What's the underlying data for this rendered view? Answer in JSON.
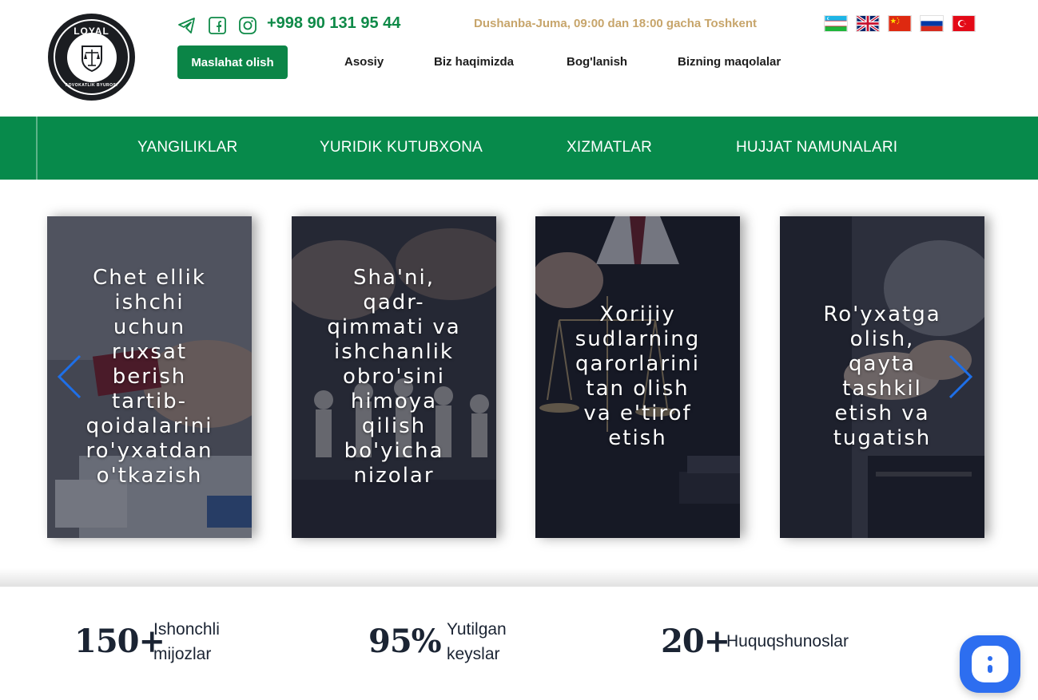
{
  "header": {
    "logo": {
      "top_text": "LOYAL",
      "bottom_text": "ADVOKATLIK BYUROSI",
      "icon": "scales-of-justice-icon"
    },
    "social": [
      {
        "icon": "telegram-icon"
      },
      {
        "icon": "facebook-icon"
      },
      {
        "icon": "instagram-icon"
      }
    ],
    "phone": "+998 90 131 95 44",
    "hours": "Dushanba-Juma, 09:00 dan 18:00 gacha Toshkent",
    "languages": [
      "uz-flag-icon",
      "gb-flag-icon",
      "cn-flag-icon",
      "ru-flag-icon",
      "tr-flag-icon"
    ],
    "cta_label": "Maslahat olish",
    "nav": [
      {
        "label": "Asosiy"
      },
      {
        "label": "Biz haqimizda"
      },
      {
        "label": "Bog'lanish"
      },
      {
        "label": "Bizning maqolalar"
      }
    ]
  },
  "main_nav": [
    {
      "label": "YANGILIKLAR"
    },
    {
      "label": "YURIDIK KUTUBXONA"
    },
    {
      "label": "XIZMATLAR"
    },
    {
      "label": "HUJJAT NAMUNALARI"
    }
  ],
  "carousel": {
    "cards": [
      {
        "lines": [
          "Chet ellik",
          "ishchi",
          "uchun",
          "ruxsat",
          "berish",
          "tartib-",
          "qoidalarini",
          "ro'yxatdan",
          "o'tkazish"
        ]
      },
      {
        "lines": [
          "Sha'ni,",
          "qadr-",
          "qimmati va",
          "ishchanlik",
          "obro'sini",
          "himoya",
          "qilish",
          "bo'yicha",
          "nizolar"
        ]
      },
      {
        "lines": [
          "Xorijiy",
          "sudlarning",
          "qarorlarini",
          "tan olish",
          "va e'tirof",
          "etish"
        ]
      },
      {
        "lines": [
          "Ro'yxatga",
          "olish,",
          "qayta",
          "tashkil",
          "etish va",
          "tugatish"
        ]
      }
    ],
    "prev_icon": "chevron-left-icon",
    "next_icon": "chevron-right-icon"
  },
  "stats": [
    {
      "number": "150+",
      "label_line1": "Ishonchli",
      "label_line2": "mijozlar"
    },
    {
      "number": "95%",
      "label_line1": "Yutilgan",
      "label_line2": "keyslar"
    },
    {
      "number": "20+",
      "label_line1": "Huquqshunoslar",
      "label_line2": ""
    }
  ],
  "chat_icon": "chat-bubble-icon",
  "colors": {
    "brand_green": "#078a4b",
    "phone_green": "#0f8a48",
    "hours_gold": "#c7a56b",
    "chat_blue": "#2d6ef0",
    "arrow_blue": "#1e6fe8"
  }
}
